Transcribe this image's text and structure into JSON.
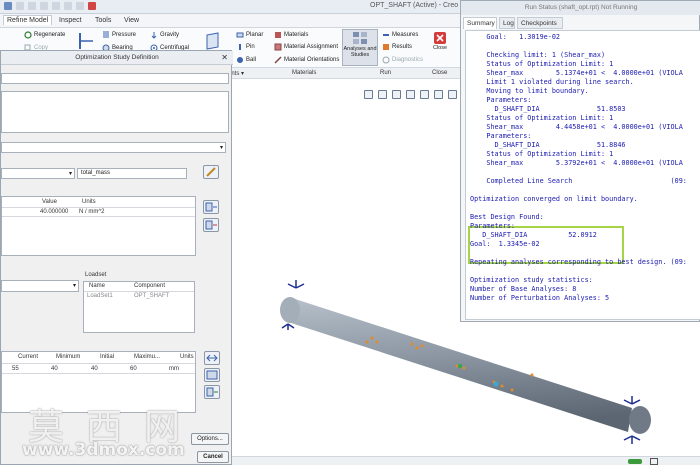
{
  "window": {
    "title": "OPT_SHAFT (Active) - Creo P",
    "menu_tabs": [
      "Refine Model",
      "Inspect",
      "Tools",
      "View"
    ]
  },
  "ribbon": {
    "buttons": {
      "regenerate": "Regenerate",
      "copy": "Copy",
      "pressure": "Pressure",
      "bearing": "Bearing",
      "gravity": "Gravity",
      "centrifugal": "Centrifugal",
      "planar": "Planar",
      "pin": "Pin",
      "ball": "Ball",
      "materials": "Materials",
      "material_assignment": "Material Assignment",
      "material_orientations": "Material Orientations",
      "analyses": "Analyses and Studies",
      "measures": "Measures",
      "results": "Results",
      "diagnostics": "Diagnostics",
      "close": "Close"
    },
    "groups": {
      "ints": "ints ▾",
      "materials": "Materials",
      "run": "Run",
      "close": "Close"
    }
  },
  "dialog": {
    "title": "Optimization Study Definition",
    "goal_value": "total_mass",
    "limits": {
      "headers": [
        "Value",
        "Units"
      ],
      "row": {
        "value": "40.000000",
        "units": "N / mm^2"
      }
    },
    "loadset": {
      "label": "Loadset",
      "headers": [
        "Name",
        "Component"
      ],
      "row": {
        "name": "LoadSet1",
        "component": "OPT_SHAFT"
      }
    },
    "params": {
      "headers": [
        "Current",
        "Minimum",
        "Initial",
        "Maximu...",
        "Units"
      ],
      "row": {
        "current": "55",
        "minimum": "40",
        "initial": "40",
        "maximum": "60",
        "units": "mm"
      }
    },
    "options_btn": "Options...",
    "cancel_btn": "Cancel"
  },
  "run_status": {
    "title": "Run Status (shaft_opt.rpt) Not Running",
    "tabs": [
      "Summary",
      "Log",
      "Checkpoints"
    ],
    "lines": [
      "    Goal:   1.3019e-02",
      "",
      "    Checking limit: 1 (Shear_max)",
      "    Status of Optimization Limit: 1",
      "    Shear_max        5.1374e+01 <  4.0000e+01 (VIOLA",
      "    Limit 1 violated during line search.",
      "    Moving to limit boundary.",
      "    Parameters:",
      "      D_SHAFT_DIA              51.8503",
      "    Status of Optimization Limit: 1",
      "    Shear_max        4.4458e+01 <  4.0000e+01 (VIOLA",
      "    Parameters:",
      "      D_SHAFT_DIA              51.8846",
      "    Status of Optimization Limit: 1",
      "    Shear_max        5.3792e+01 <  4.0000e+01 (VIOLA",
      "",
      "    Completed Line Search                        (09:",
      "",
      "Optimization converged on limit boundary.",
      "",
      "Best Design Found:",
      "Parameters:",
      "   D_SHAFT_DIA          52.0912",
      "Goal:  1.3345e-02",
      "",
      "Repeating analyses corresponding to best design. (09:",
      "",
      "Optimization study statistics:",
      "Number of Base Analyses: 8",
      "Number of Perturbation Analyses: 5"
    ]
  },
  "watermark": {
    "chinese": "莫西网",
    "url": "www.3dmox.com"
  },
  "colors": {
    "highlight_box": "#a5d445",
    "log_text": "#1a1ab0",
    "shaft": "#8f9aa6"
  }
}
